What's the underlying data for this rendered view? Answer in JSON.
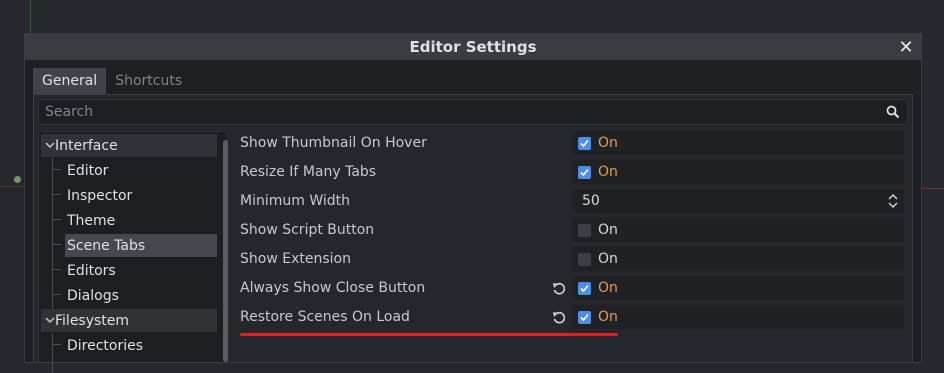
{
  "window": {
    "title": "Editor Settings",
    "close_label": "✕"
  },
  "tabs": [
    {
      "label": "General",
      "active": true
    },
    {
      "label": "Shortcuts",
      "active": false
    }
  ],
  "search": {
    "placeholder": "Search"
  },
  "tree": {
    "items": [
      {
        "label": "Interface",
        "kind": "category"
      },
      {
        "label": "Editor",
        "kind": "sub"
      },
      {
        "label": "Inspector",
        "kind": "sub"
      },
      {
        "label": "Theme",
        "kind": "sub"
      },
      {
        "label": "Scene Tabs",
        "kind": "sub",
        "selected": true
      },
      {
        "label": "Editors",
        "kind": "sub"
      },
      {
        "label": "Dialogs",
        "kind": "sub"
      },
      {
        "label": "Filesystem",
        "kind": "category"
      },
      {
        "label": "Directories",
        "kind": "sub"
      }
    ]
  },
  "properties": [
    {
      "label": "Show Thumbnail On Hover",
      "type": "bool",
      "checked": true,
      "value": "On",
      "revert": false
    },
    {
      "label": "Resize If Many Tabs",
      "type": "bool",
      "checked": true,
      "value": "On",
      "revert": false
    },
    {
      "label": "Minimum Width",
      "type": "number",
      "value": "50",
      "revert": false
    },
    {
      "label": "Show Script Button",
      "type": "bool",
      "checked": false,
      "value": "On",
      "revert": false
    },
    {
      "label": "Show Extension",
      "type": "bool",
      "checked": false,
      "value": "On",
      "revert": false
    },
    {
      "label": "Always Show Close Button",
      "type": "bool",
      "checked": true,
      "value": "On",
      "revert": true
    },
    {
      "label": "Restore Scenes On Load",
      "type": "bool",
      "checked": true,
      "value": "On",
      "revert": true
    }
  ],
  "colors": {
    "accent_checkbox": "#4d8ee8",
    "value_on": "#e89a56",
    "highlight_underline": "#e0211f"
  }
}
